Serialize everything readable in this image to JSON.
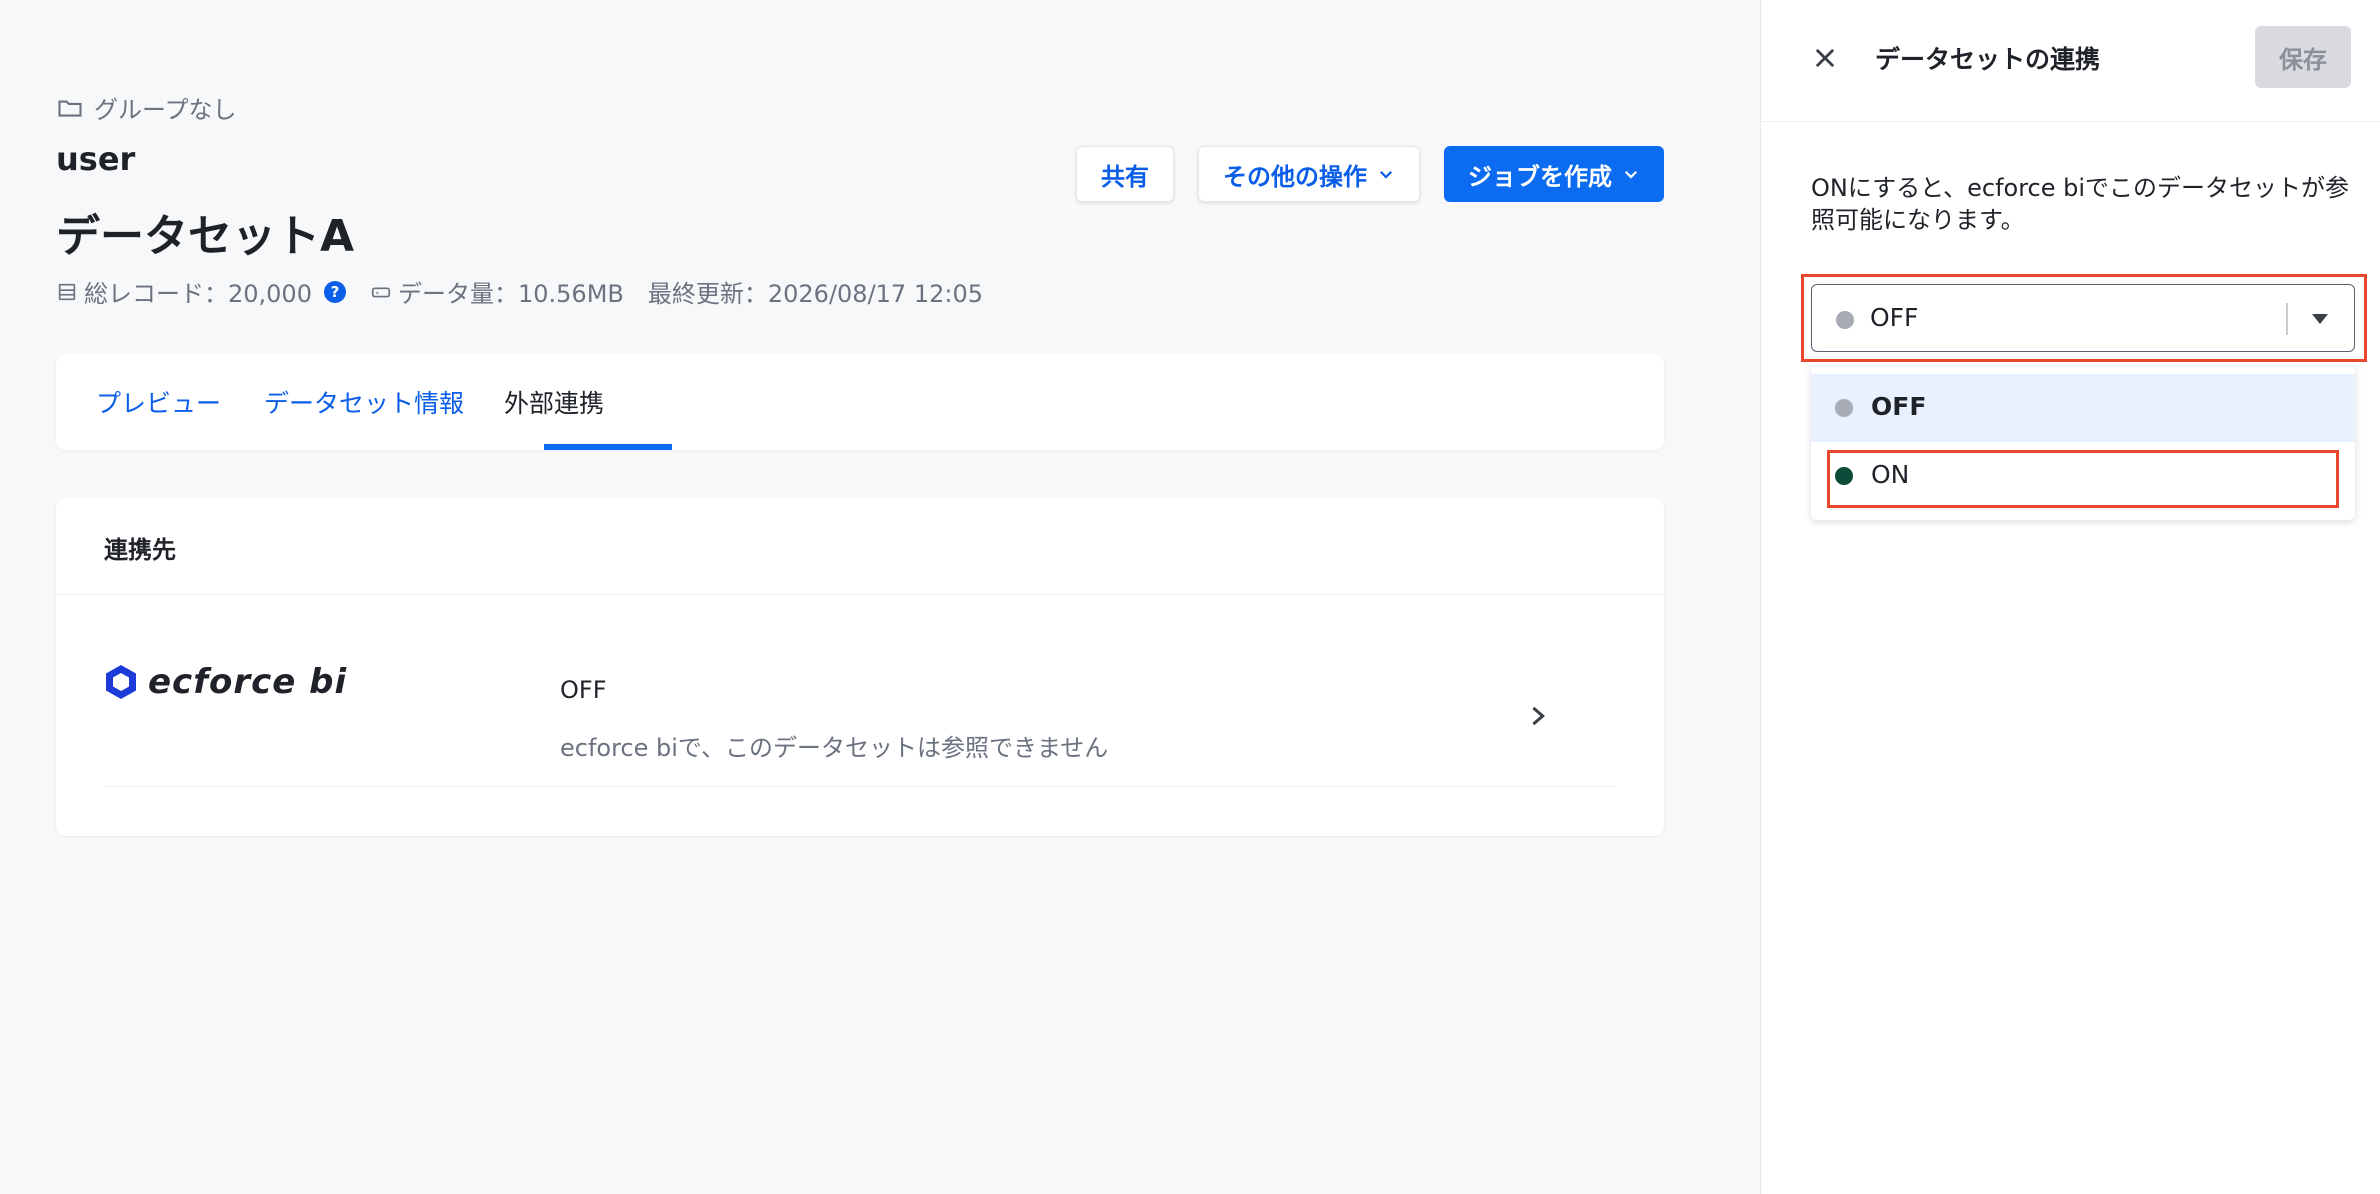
{
  "breadcrumb": {
    "label": "グループなし"
  },
  "owner": "user",
  "dataset": {
    "title": "データセットA",
    "records_label": "総レコード：20,000",
    "size_label": "データ量：10.56MB",
    "updated_label": "最終更新：2026/08/17 12:05"
  },
  "actions": {
    "share": "共有",
    "more": "その他の操作",
    "create_job": "ジョブを作成"
  },
  "tabs": [
    {
      "label": "プレビュー"
    },
    {
      "label": "データセット情報"
    },
    {
      "label": "外部連携"
    }
  ],
  "link_card": {
    "title": "連携先",
    "integration_name": "ecforce bi",
    "status": "OFF",
    "description": "ecforce biで、このデータセットは参照できません"
  },
  "panel": {
    "title": "データセットの連携",
    "save_label": "保存",
    "description": "ONにすると、ecforce biでこのデータセットが参照可能になります。",
    "select_value": "OFF",
    "options": [
      {
        "label": "OFF",
        "color": "#a7abb6"
      },
      {
        "label": "ON",
        "color": "#0d4a3a"
      }
    ]
  },
  "colors": {
    "accent": "#0b6cf2",
    "highlight": "#e8472e",
    "off_dot": "#a7abb6",
    "on_dot": "#0d4a3a"
  }
}
